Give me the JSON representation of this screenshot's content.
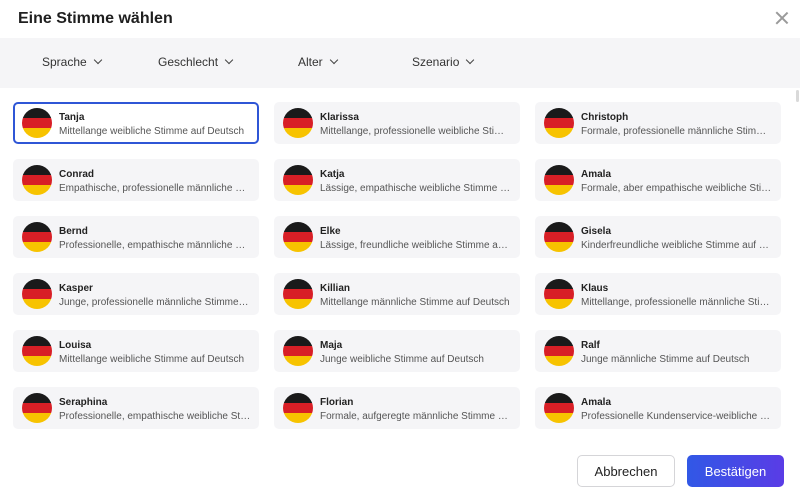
{
  "dialog": {
    "title": "Eine Stimme wählen"
  },
  "filters": [
    {
      "label": "Sprache"
    },
    {
      "label": "Geschlecht"
    },
    {
      "label": "Alter"
    },
    {
      "label": "Szenario"
    }
  ],
  "voices": [
    {
      "name": "Tanja",
      "desc": "Mittellange weibliche Stimme auf Deutsch",
      "selected": true
    },
    {
      "name": "Klarissa",
      "desc": "Mittellange, professionelle weibliche Stimme auf Deutsch"
    },
    {
      "name": "Christoph",
      "desc": "Formale, professionelle männliche Stimme auf Deutsch"
    },
    {
      "name": "Conrad",
      "desc": "Empathische, professionelle männliche Stimme auf Deutsch"
    },
    {
      "name": "Katja",
      "desc": "Lässige, empathische weibliche Stimme auf Deutsch"
    },
    {
      "name": "Amala",
      "desc": "Formale, aber empathische weibliche Stimme auf Deutsch"
    },
    {
      "name": "Bernd",
      "desc": "Professionelle, empathische männliche Stimme auf Deutsch"
    },
    {
      "name": "Elke",
      "desc": "Lässige, freundliche weibliche Stimme auf Deutsch"
    },
    {
      "name": "Gisela",
      "desc": "Kinderfreundliche weibliche Stimme auf Deutsch"
    },
    {
      "name": "Kasper",
      "desc": "Junge, professionelle männliche Stimme auf Deutsch"
    },
    {
      "name": "Killian",
      "desc": "Mittellange männliche Stimme auf Deutsch"
    },
    {
      "name": "Klaus",
      "desc": "Mittellange, professionelle männliche Stimme auf Deutsch"
    },
    {
      "name": "Louisa",
      "desc": "Mittellange weibliche Stimme auf Deutsch"
    },
    {
      "name": "Maja",
      "desc": "Junge weibliche Stimme auf Deutsch"
    },
    {
      "name": "Ralf",
      "desc": "Junge männliche Stimme auf Deutsch"
    },
    {
      "name": "Seraphina",
      "desc": "Professionelle, empathische weibliche Stimme auf Deutsch"
    },
    {
      "name": "Florian",
      "desc": "Formale, aufgeregte männliche Stimme auf Deutsch"
    },
    {
      "name": "Amala",
      "desc": "Professionelle Kundenservice-weibliche Stimme auf Deutsch"
    }
  ],
  "flag_icon": "germany-flag-icon",
  "buttons": {
    "cancel": "Abbrechen",
    "confirm": "Bestätigen"
  },
  "colors": {
    "accent": "#2f56d6",
    "confirm_start": "#3158e6",
    "confirm_end": "#5a3ce6"
  }
}
